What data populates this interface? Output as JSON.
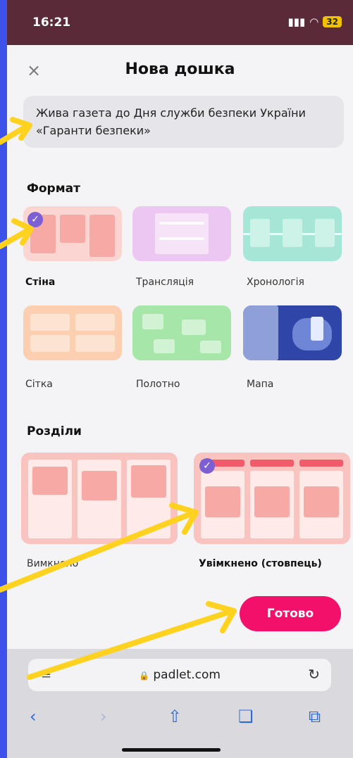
{
  "status": {
    "time": "16:21",
    "battery": "32"
  },
  "header": {
    "close_icon": "×",
    "title": "Нова дошка"
  },
  "board_name": "Жива газета до Дня служби безпеки України «Гаранти безпеки»",
  "format": {
    "title": "Формат",
    "options": [
      {
        "label": "Стіна",
        "selected": true
      },
      {
        "label": "Трансляція",
        "selected": false
      },
      {
        "label": "Хронологія",
        "selected": false
      },
      {
        "label": "Сітка",
        "selected": false
      },
      {
        "label": "Полотно",
        "selected": false
      },
      {
        "label": "Мапа",
        "selected": false
      }
    ]
  },
  "sections": {
    "title": "Розділи",
    "options": [
      {
        "label": "Вимкнено",
        "selected": false
      },
      {
        "label": "Увімкнено (стовпець)",
        "selected": true
      }
    ]
  },
  "done_label": "Готово",
  "browser": {
    "url": "padlet.com",
    "lock_icon": "🔒",
    "reload_icon": "↻"
  },
  "colors": {
    "accent": "#f2106b",
    "check": "#7b5fd3",
    "arrows": "#ffd21f",
    "background": "#3d52e8"
  }
}
